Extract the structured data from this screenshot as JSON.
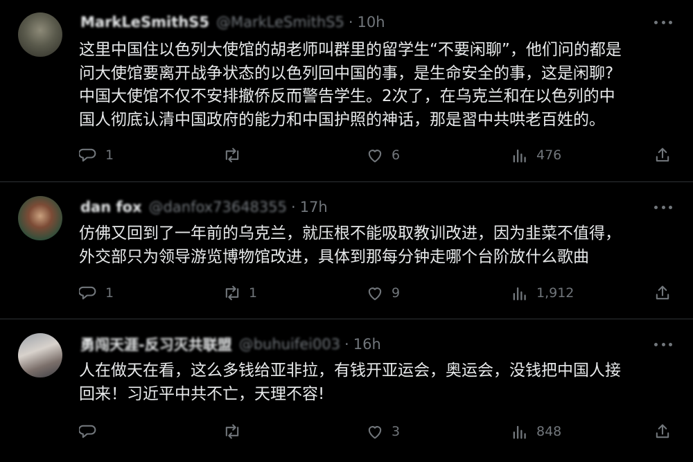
{
  "tweets": [
    {
      "author": "MarkLeSmithS5",
      "handle": "@MarkLeSmithS5",
      "time": "10h",
      "lines": [
        "这里中国住以色列大使馆的胡老师叫群里的留学生“不要闲聊”，他们问的都是",
        "问大使馆要离开战争状态的以色列回中国的事，是生命安全的事，这是闲聊?",
        "中国大使馆不仅不安排撤侨反而警告学生。2次了，在乌克兰和在以色列的中",
        "国人彻底认清中国政府的能力和中国护照的神话，那是習中共哄老百姓的。"
      ],
      "replies": "1",
      "reposts": "",
      "likes": "6",
      "views": "476"
    },
    {
      "author": "dan fox",
      "handle": "@danfox73648355",
      "time": "17h",
      "lines": [
        "仿佛又回到了一年前的乌克兰，就压根不能吸取教训改进，因为韭菜不值得，",
        "外交部只为领导游览博物馆改进，具体到那每分钟走哪个台阶放什么歌曲"
      ],
      "replies": "1",
      "reposts": "1",
      "likes": "9",
      "views": "1,912"
    },
    {
      "author": "勇闯天涯-反习灭共联盟",
      "handle": "@buhuifei003",
      "time": "16h",
      "lines": [
        "人在做天在看，这么多钱给亚非拉，有钱开亚运会，奥运会，没钱把中国人接",
        "回来！习近平中共不亡，天理不容!"
      ],
      "replies": "",
      "reposts": "",
      "likes": "3",
      "views": "848"
    }
  ],
  "icons": [
    "reply-icon",
    "repost-icon",
    "like-icon",
    "views-icon",
    "share-icon",
    "more-icon"
  ],
  "colors": {
    "background": "#000000",
    "text": "#e7e9ea",
    "muted": "#71767b",
    "divider": "#2f3336"
  }
}
